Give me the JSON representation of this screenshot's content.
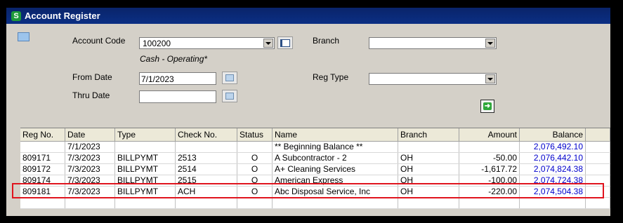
{
  "window": {
    "title": "Account Register"
  },
  "form": {
    "account_code_label": "Account Code",
    "account_code_value": "100200",
    "account_desc": "Cash - Operating*",
    "branch_label": "Branch",
    "branch_value": "",
    "from_date_label": "From Date",
    "from_date_value": "7/1/2023",
    "thru_date_label": "Thru Date",
    "thru_date_value": "",
    "reg_type_label": "Reg Type",
    "reg_type_value": ""
  },
  "grid": {
    "columns": [
      "Reg No.",
      "Date",
      "Type",
      "Check No.",
      "Status",
      "Name",
      "Branch",
      "Amount",
      "Balance"
    ],
    "rows": [
      {
        "reg_no": "",
        "date": "7/1/2023",
        "type": "",
        "check_no": "",
        "status": "",
        "name": "** Beginning Balance **",
        "branch": "",
        "amount": "",
        "balance": "2,076,492.10"
      },
      {
        "reg_no": "809171",
        "date": "7/3/2023",
        "type": "BILLPYMT",
        "check_no": "2513",
        "status": "O",
        "name": "A Subcontractor - 2",
        "branch": "OH",
        "amount": "-50.00",
        "balance": "2,076,442.10"
      },
      {
        "reg_no": "809172",
        "date": "7/3/2023",
        "type": "BILLPYMT",
        "check_no": "2514",
        "status": "O",
        "name": "A+ Cleaning Services",
        "branch": "OH",
        "amount": "-1,617.72",
        "balance": "2,074,824.38"
      },
      {
        "reg_no": "809174",
        "date": "7/3/2023",
        "type": "BILLPYMT",
        "check_no": "2515",
        "status": "O",
        "name": "American Express",
        "branch": "OH",
        "amount": "-100.00",
        "balance": "2,074,724.38"
      },
      {
        "reg_no": "809181",
        "date": "7/3/2023",
        "type": "BILLPYMT",
        "check_no": "ACH",
        "status": "O",
        "name": "Abc Disposal Service, Inc",
        "branch": "OH",
        "amount": "-220.00",
        "balance": "2,074,504.38"
      }
    ]
  },
  "colors": {
    "titlebar": "#0a246a",
    "highlight": "#e0141e",
    "balance_text": "#0000cc",
    "panel": "#d4d0c8"
  }
}
